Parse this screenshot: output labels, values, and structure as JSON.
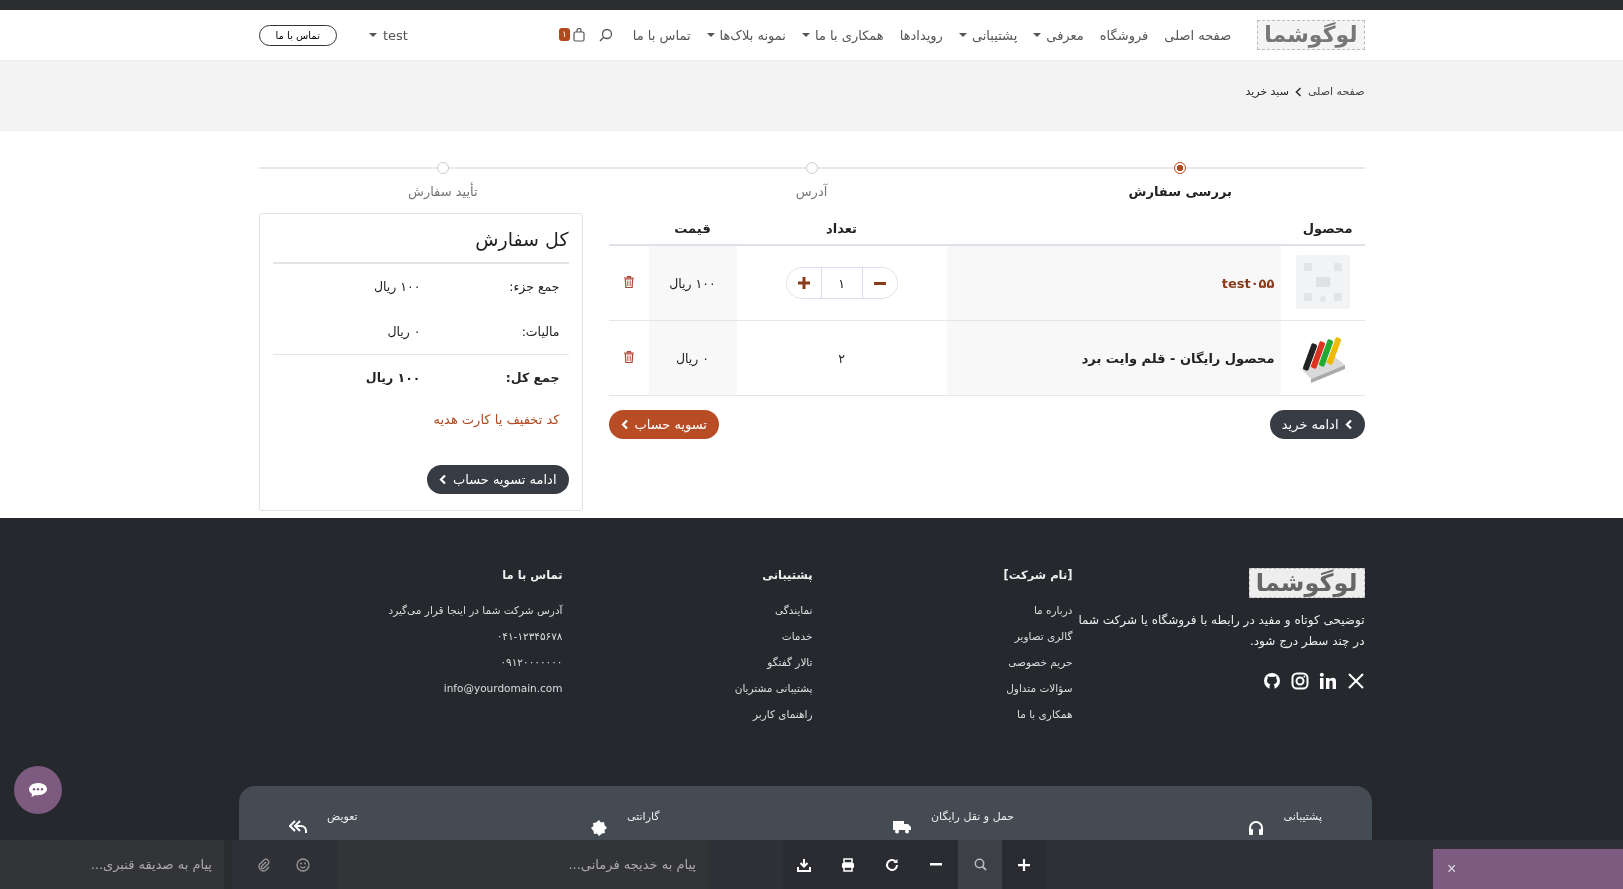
{
  "nav": {
    "logo": "لوگوشما",
    "items": [
      {
        "label": "صفحه اصلی",
        "dropdown": false
      },
      {
        "label": "فروشگاه",
        "dropdown": false
      },
      {
        "label": "معرفی",
        "dropdown": true
      },
      {
        "label": "پشتیبانی",
        "dropdown": true
      },
      {
        "label": "رویدادها",
        "dropdown": false
      },
      {
        "label": "همکاری با ما",
        "dropdown": true
      },
      {
        "label": "نمونه بلاک‌ها",
        "dropdown": true
      },
      {
        "label": "تماس با ما",
        "dropdown": false
      }
    ],
    "cart_count": "۱",
    "user": "test",
    "contact_button": "تماس با ما"
  },
  "breadcrumb": [
    "صفحه اصلی",
    "سبد خرید"
  ],
  "steps": [
    {
      "label": "بررسی سفارش",
      "selected": true
    },
    {
      "label": "آدرس",
      "selected": false
    },
    {
      "label": "تأیید سفارش",
      "selected": false
    }
  ],
  "cart": {
    "columns": [
      "محصول",
      "تعداد",
      "قیمت"
    ],
    "rows": [
      {
        "name": "test۰۵۵",
        "kind": "stepper",
        "quantity": "۱",
        "price": "۱۰۰ ریال"
      },
      {
        "name": "محصول رایگان - قلم وایت برد",
        "kind": "fixed",
        "quantity": "۲",
        "price": "۰ ریال"
      }
    ],
    "continue_button": "ادامه خرید",
    "checkout_button": "تسویه حساب"
  },
  "summary": {
    "title": "کل سفارش",
    "lines": [
      {
        "label": "جمع جزء:",
        "value": "۱۰۰ ریال",
        "kind": "normal"
      },
      {
        "label": "مالیات:",
        "value": "۰ ریال",
        "kind": "normal"
      },
      {
        "label": "جمع کل:",
        "value": "۱۰۰ ریال",
        "kind": "total"
      }
    ],
    "promo_link": "کد تخفیف یا کارت هدیه",
    "button": "ادامه تسویه حساب"
  },
  "footer": {
    "logo": "لوگوشما",
    "description": "توضیحی کوتاه و مفید در رابطه با فروشگاه یا شرکت شما در چند سطر درج شود.",
    "columns": [
      {
        "title": "[نام شرکت]",
        "links": [
          "درباره ما",
          "گالری تصاویر",
          "حریم خصوصی",
          "سؤالات متداول",
          "همکاری با ما"
        ]
      },
      {
        "title": "پشتیبانی",
        "links": [
          "نمایندگی",
          "خدمات",
          "تالار گفتگو",
          "پشتیبانی مشتریان",
          "راهنمای کاربر"
        ]
      },
      {
        "title": "تماس با ما",
        "links": [
          "آدرس شرکت شما در اینجا قرار می‌گیرد",
          "۰۴۱-۱۲۳۴۵۶۷۸",
          "۰۹۱۲۰۰۰۰۰۰۰",
          "info@yourdomain.com"
        ]
      }
    ]
  },
  "features": [
    {
      "label": "پشتیبانی"
    },
    {
      "label": "حمل و نقل رایگان"
    },
    {
      "label": "گارانتی"
    },
    {
      "label": "تعویض"
    }
  ],
  "bottom_bar": {
    "inputs": [
      {
        "placeholder": "پیام به خدیجه فرمانی..."
      },
      {
        "placeholder": "پیام به صدیقه قنبری..."
      }
    ],
    "close": "×"
  }
}
